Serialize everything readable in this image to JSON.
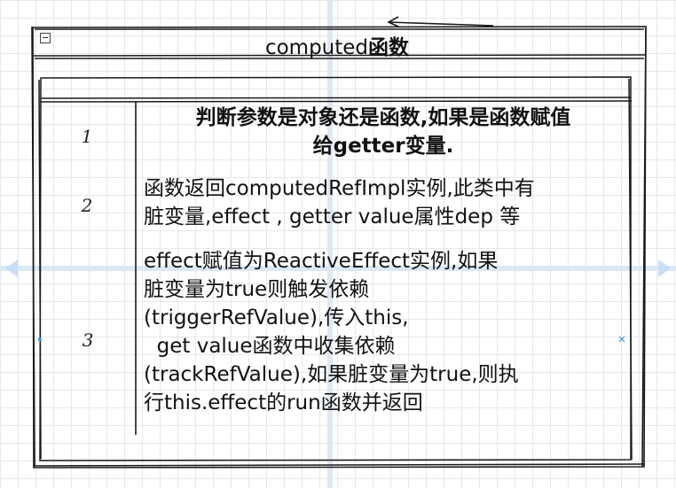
{
  "title": {
    "prefix": "computed",
    "suffix": "函数"
  },
  "rows": [
    {
      "num": "1",
      "lines": [
        "判断参数是对象还是函数,如果是函数赋值",
        "给getter变量."
      ]
    },
    {
      "num": "2",
      "lines": [
        "函数返回computedRefImpl实例,此类中有",
        "脏变量,effect , getter value属性dep 等"
      ]
    },
    {
      "num": "3",
      "lines": [
        "effect赋值为ReactiveEffect实例,如果",
        "脏变量为true则触发依赖",
        "(triggerRefValue),传入this,",
        "  get value函数中收集依赖",
        "(trackRefValue),如果脏变量为true,则执",
        "行this.effect的run函数并返回"
      ]
    }
  ],
  "colors": {
    "stroke": "#1a1a1a",
    "grid": "#e4e8ee",
    "guide": "#dde8f5",
    "arrow": "#c9def4"
  }
}
